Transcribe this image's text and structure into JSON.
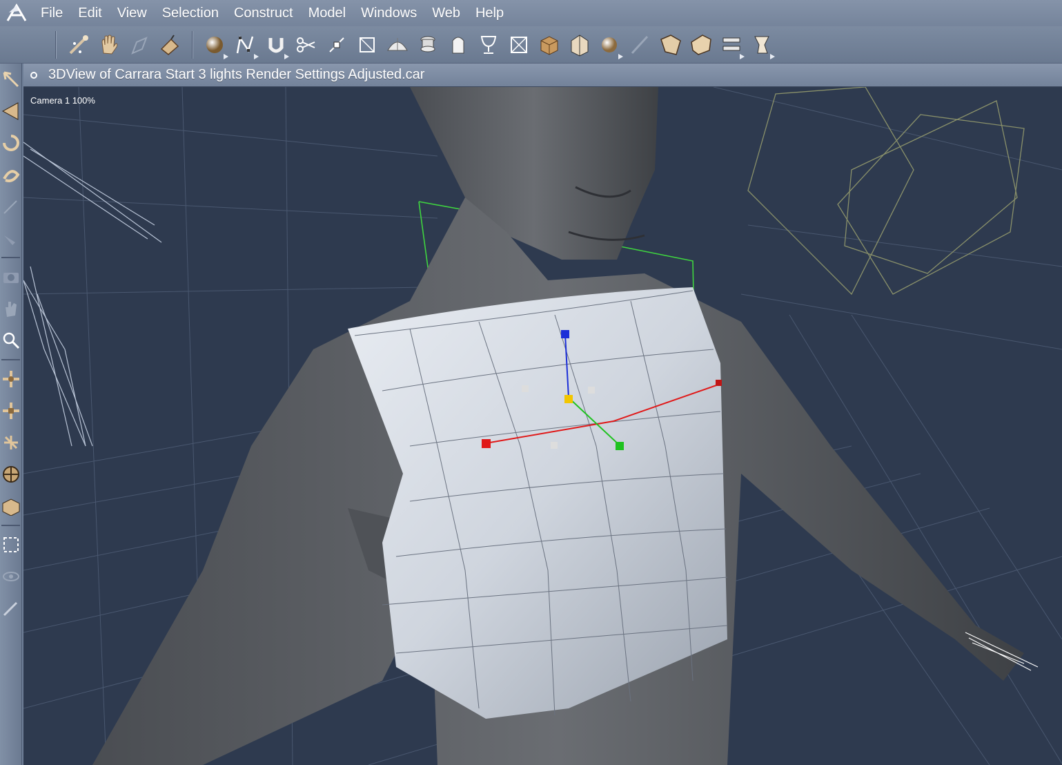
{
  "menu": {
    "items": [
      "File",
      "Edit",
      "View",
      "Selection",
      "Construct",
      "Model",
      "Windows",
      "Web",
      "Help"
    ]
  },
  "toolbar": {
    "group1": [
      "magic-wand-icon",
      "grab-hand-icon",
      "disabled-hand-icon",
      "paint-bucket-icon"
    ],
    "group2": [
      "sphere-icon",
      "spline-icon",
      "magnet-icon",
      "scissors-icon",
      "vertex-move-icon",
      "crop-icon",
      "dome-icon",
      "lathe-icon",
      "extrude-icon",
      "goblet-icon",
      "box-icon",
      "cube-icon",
      "package-icon",
      "ball-icon",
      "brush-icon",
      "morph-a-icon",
      "morph-b-icon",
      "align-icon",
      "bend-icon"
    ]
  },
  "lefttools": [
    "arrow-select-icon",
    "move-icon",
    "rotate-icon",
    "twist-icon",
    "knife-icon",
    "smudge-icon",
    "camera-icon",
    "hand-pan-icon",
    "zoom-icon",
    "move-3d-icon",
    "scale-3d-icon",
    "rotate-3d-icon",
    "sphere-rotate-icon",
    "box-select-icon",
    "rect-select-icon",
    "eye-icon",
    "pencil-icon"
  ],
  "view": {
    "title": "3DView of Carrara Start 3 lights Render Settings Adjusted.car",
    "camera_label": "Camera 1 100%"
  },
  "colors": {
    "scene_bg": "#2e3a4f",
    "grid": "#4a5870",
    "figure": "#5c5f63",
    "garment": "#d7dce4",
    "selection_green": "#3fd53f",
    "axis_red": "#e01919",
    "axis_blue": "#1c2fd8",
    "axis_green": "#1fc21f"
  }
}
